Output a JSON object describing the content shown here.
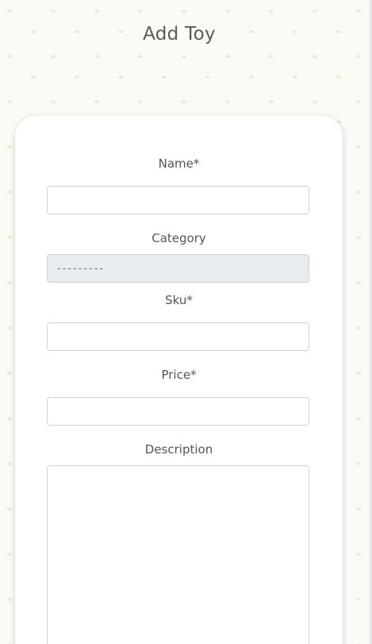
{
  "page": {
    "title": "Add Toy"
  },
  "form": {
    "name": {
      "label": "Name*",
      "value": ""
    },
    "category": {
      "label": "Category",
      "selected": "---------"
    },
    "sku": {
      "label": "Sku*",
      "value": ""
    },
    "price": {
      "label": "Price*",
      "value": ""
    },
    "description": {
      "label": "Description",
      "value": ""
    }
  },
  "colors": {
    "background": "#fbfbf6",
    "leaf_pattern": "#e8ecd2",
    "card": "#ffffff",
    "select_bg": "#e9ecef"
  }
}
